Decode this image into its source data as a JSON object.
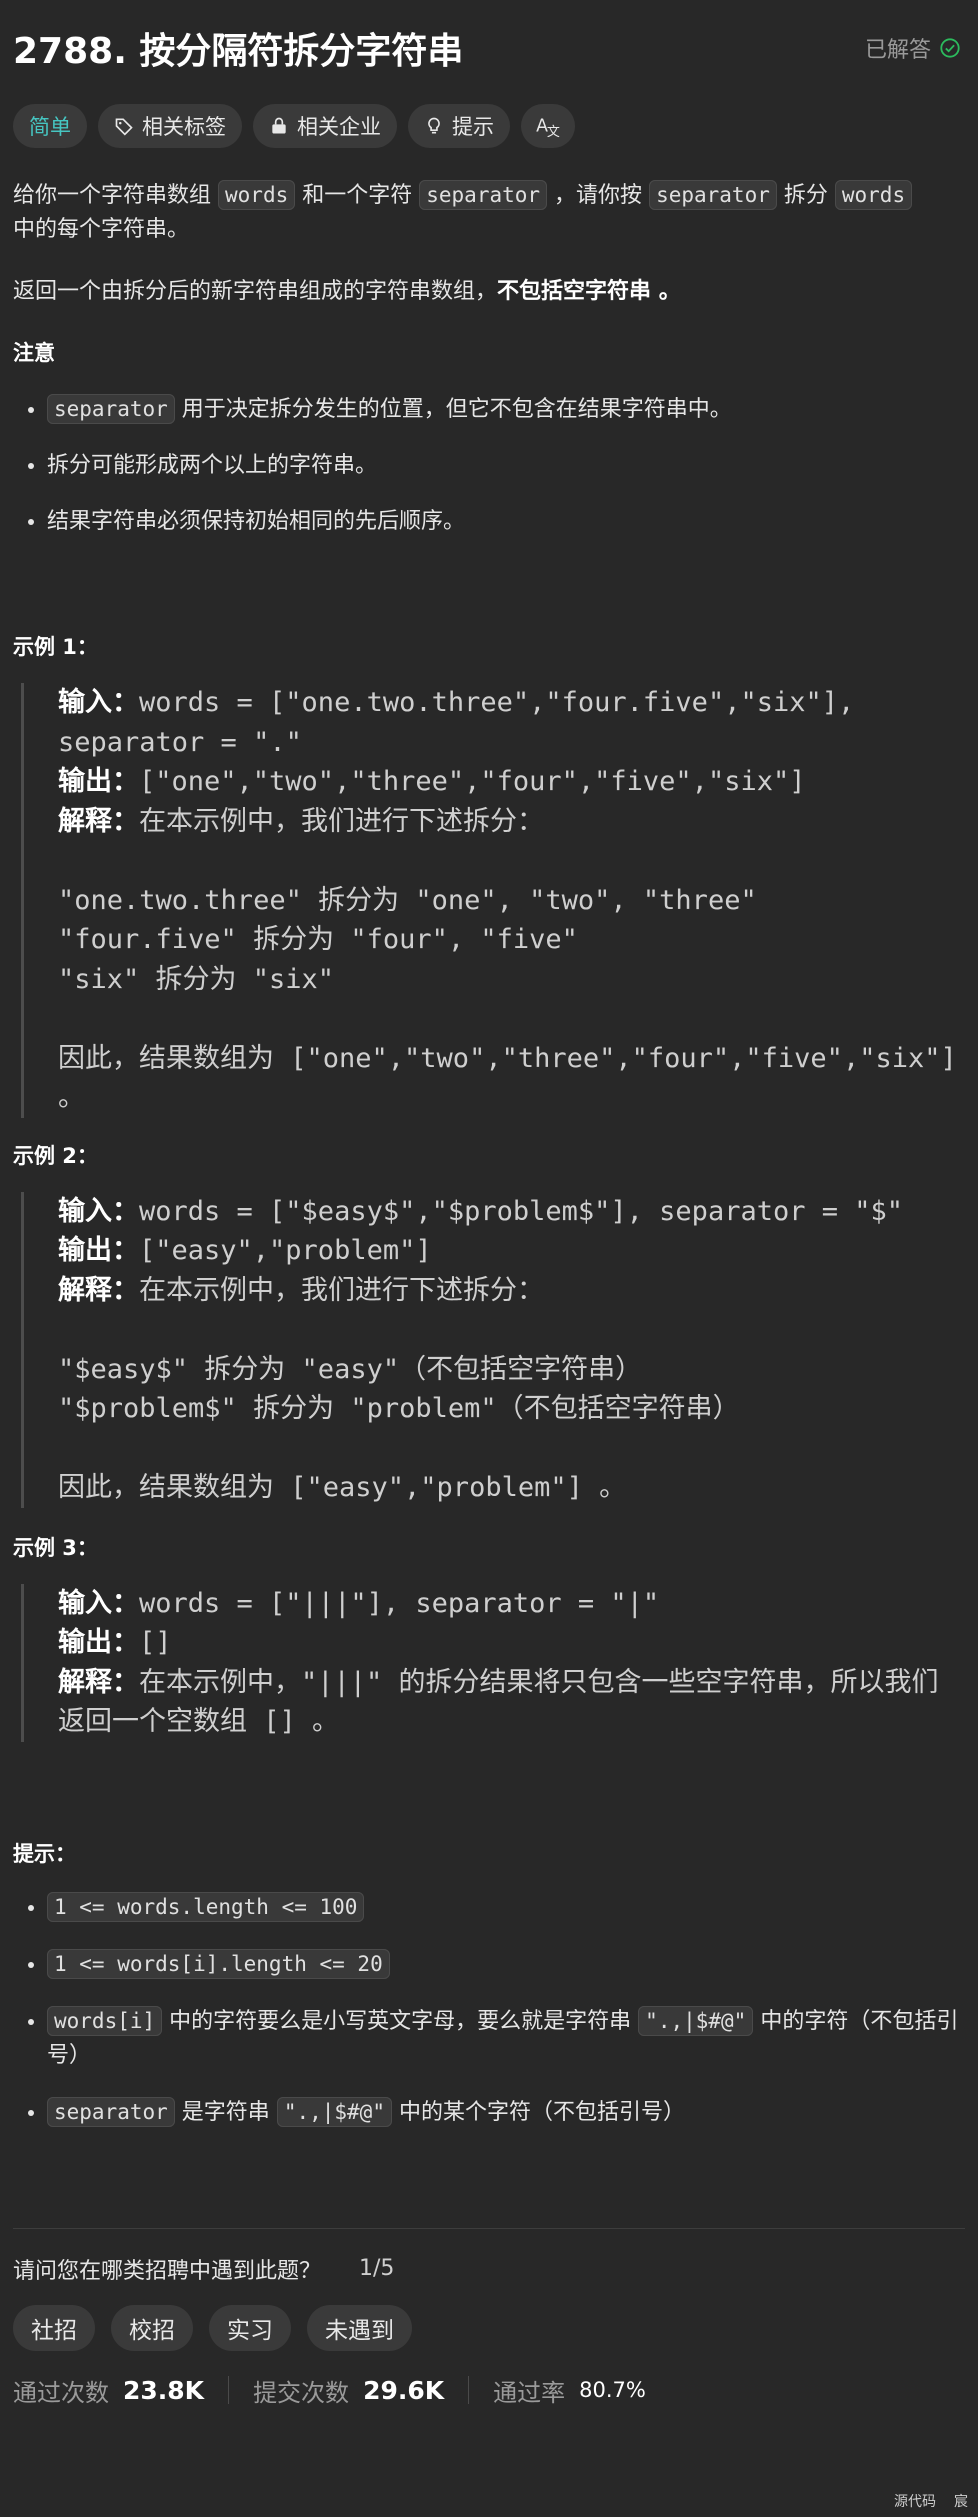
{
  "problem": {
    "title": "2788. 按分隔符拆分字符串",
    "status": "已解答",
    "status_color": "#2cbb5d"
  },
  "tags": [
    {
      "label": "简单",
      "icon": ""
    },
    {
      "label": "相关标签",
      "icon": "tag-icon"
    },
    {
      "label": "相关企业",
      "icon": "lock-icon"
    },
    {
      "label": "提示",
      "icon": "lightbulb-icon"
    },
    {
      "label": "",
      "icon": "translate-icon"
    }
  ],
  "description": {
    "p1_a": "给你一个字符串数组",
    "p1_words": "words",
    "p1_b": "和一个字符",
    "p1_sep": "separator",
    "p1_c": "，请你按",
    "p1_sep2": "separator",
    "p1_d": "拆分",
    "p1_words2": "words",
    "p1_e": "中的每个字符串。",
    "p2_a": "返回一个由拆分后的新字符串组成的字符串数组，",
    "p2_bold": "不包括空字符串",
    "p2_c": " 。",
    "note_heading": "注意",
    "note1_code": "separator",
    "note1_text": "用于决定拆分发生的位置，但它不包含在结果字符串中。",
    "note2": "拆分可能形成两个以上的字符串。",
    "note3": "结果字符串必须保持初始相同的先后顺序。"
  },
  "examples": [
    {
      "heading": "示例 1：",
      "input_label": "输入：",
      "input": "words = [\"one.two.three\",\"four.five\",\"six\"], separator = \".\"",
      "output_label": "输出：",
      "output": "[\"one\",\"two\",\"three\",\"four\",\"five\",\"six\"]",
      "expl_label": "解释：",
      "expl": "在本示例中，我们进行下述拆分：\n\n\"one.two.three\" 拆分为 \"one\", \"two\", \"three\"\n\"four.five\" 拆分为 \"four\", \"five\"\n\"six\" 拆分为 \"six\"\n\n因此，结果数组为 [\"one\",\"two\",\"three\",\"four\",\"five\",\"six\"] 。"
    },
    {
      "heading": "示例 2：",
      "input_label": "输入：",
      "input": "words = [\"$easy$\",\"$problem$\"], separator = \"$\"",
      "output_label": "输出：",
      "output": "[\"easy\",\"problem\"]",
      "expl_label": "解释：",
      "expl": "在本示例中，我们进行下述拆分：\n\n\"$easy$\" 拆分为 \"easy\"（不包括空字符串）\n\"$problem$\" 拆分为 \"problem\"（不包括空字符串）\n\n因此，结果数组为 [\"easy\",\"problem\"] 。"
    },
    {
      "heading": "示例 3：",
      "input_label": "输入：",
      "input": "words = [\"|||\"], separator = \"|\"",
      "output_label": "输出：",
      "output": "[]",
      "expl_label": "解释：",
      "expl": "在本示例中，\"|||\" 的拆分结果将只包含一些空字符串，所以我们返回一个空数组 [] 。"
    }
  ],
  "hints": {
    "heading": "提示：",
    "h1": "1 <= words.length <= 100",
    "h2": "1 <= words[i].length <= 20",
    "h3_code": "words[i]",
    "h3_a": "中的字符要么是小写英文字母，要么就是字符串",
    "h3_code2": "\".,|$#@\"",
    "h3_b": "中的字符（不包括引号）",
    "h4_code": "separator",
    "h4_a": "是字符串",
    "h4_code2": "\".,|$#@\"",
    "h4_b": "中的某个字符（不包括引号）"
  },
  "survey": {
    "question": "请问您在哪类招聘中遇到此题？",
    "page": "1/5",
    "options": [
      "社招",
      "校招",
      "实习",
      "未遇到"
    ]
  },
  "stats": {
    "accepted_label": "通过次数",
    "accepted": "23.8K",
    "submitted_label": "提交次数",
    "submitted": "29.6K",
    "rate_label": "通过率",
    "rate": "80.7%"
  },
  "corner": {
    "left": "源代码",
    "right": "宸"
  }
}
